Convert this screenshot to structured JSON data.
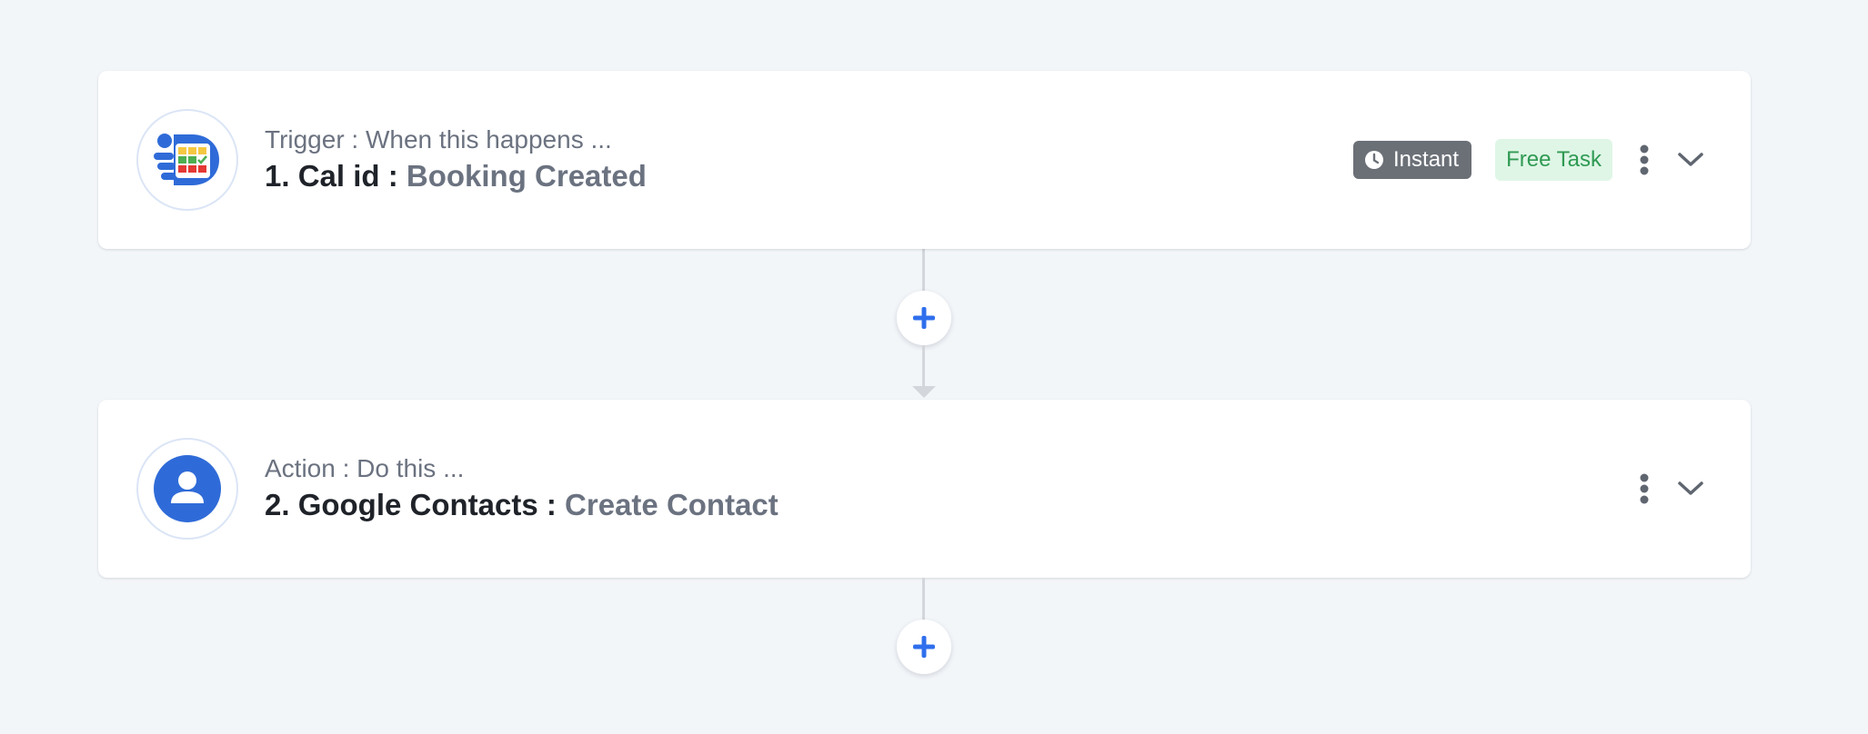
{
  "steps": [
    {
      "label": "Trigger : When this happens ...",
      "title": "1. Cal id :",
      "event": "Booking Created",
      "app_icon": "cal-id-logo",
      "badges": {
        "instant": "Instant",
        "free_task": "Free Task"
      }
    },
    {
      "label": "Action : Do this ...",
      "title": "2. Google Contacts :",
      "event": "Create Contact",
      "app_icon": "google-contacts-logo"
    }
  ],
  "icons": {
    "more": "vertical-dots-icon",
    "expand": "chevron-down-icon",
    "add": "plus-icon",
    "clock": "clock-icon"
  },
  "colors": {
    "background": "#f3f6f9",
    "accent_blue": "#2f6fed",
    "instant_badge": "#6b7077",
    "free_task_bg": "#dff6e6",
    "free_task_text": "#2f9a53",
    "contacts_blue": "#2f6bd8"
  }
}
